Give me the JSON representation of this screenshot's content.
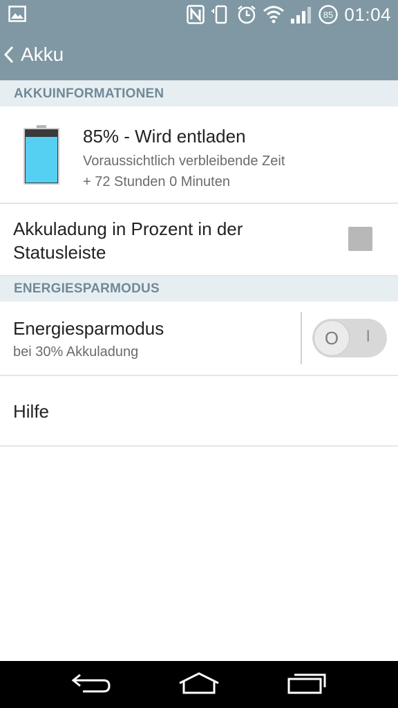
{
  "status_bar": {
    "time": "01:04",
    "battery_badge": "85",
    "icons": [
      "image-icon",
      "nfc-icon",
      "vibrate-icon",
      "alarm-icon",
      "wifi-icon",
      "signal-icon",
      "battery-icon"
    ]
  },
  "header": {
    "title": "Akku",
    "back_icon": "chevron-left-icon"
  },
  "sections": {
    "battery_info": "AKKUINFORMATIONEN",
    "power_saving": "ENERGIESPARMODUS"
  },
  "battery": {
    "status": "85% - Wird entladen",
    "remaining_label": "Voraussichtlich verbleibende Zeit",
    "remaining_value": "+ 72 Stunden 0 Minuten",
    "level_fraction": 0.85,
    "fill_color": "#55d0f2"
  },
  "percent_in_statusbar": {
    "label": "Akkuladung in Prozent in der Statusleiste",
    "checked": false
  },
  "power_saving": {
    "label": "Energiesparmodus",
    "sublabel": "bei 30% Akkuladung",
    "enabled": false,
    "off_glyph": "O",
    "on_glyph": "I"
  },
  "help": {
    "label": "Hilfe"
  },
  "colors": {
    "bar": "#7f98a3",
    "section_bg": "#e7eef2",
    "section_text": "#6f8a97"
  }
}
